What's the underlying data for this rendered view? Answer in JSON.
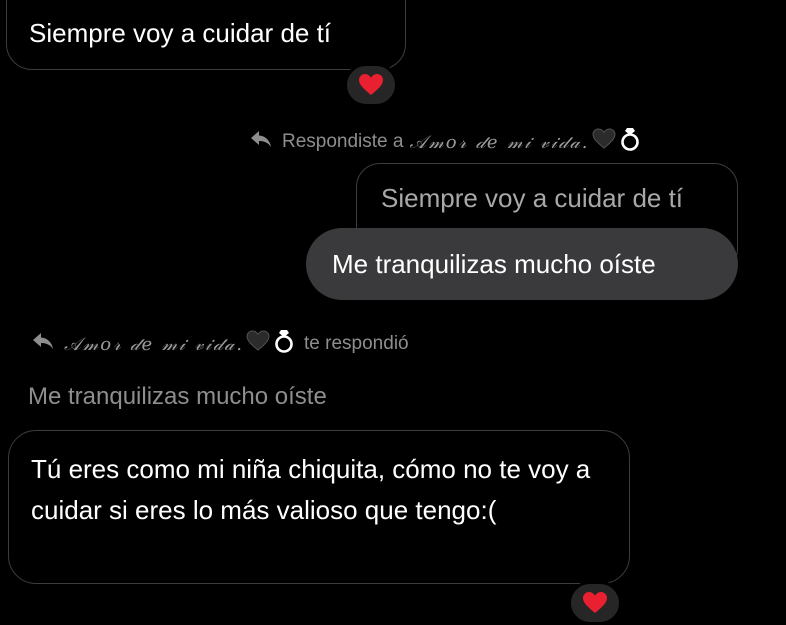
{
  "messages": {
    "first": "Siempre voy a cuidar de tí",
    "reply_meta": {
      "prefix": "Respondiste a",
      "name": "𝒜𝓂𝑜𝓇 𝒹𝑒 𝓂𝒾 𝓋𝒾𝒹𝒶."
    },
    "quoted_reply": "Siempre voy a cuidar de tí",
    "my_reply": "Me tranquilizas mucho oíste",
    "their_reply_meta": {
      "name": "𝒜𝓂𝑜𝓇 𝒹𝑒 𝓂𝒾 𝓋𝒾𝒹𝒶.",
      "suffix": "te respondió"
    },
    "quoted_their": "Me tranquilizas mucho oíste",
    "their_reply": "Tú eres como mi niña chiquita, cómo no te voy a cuidar si eres lo más valioso que tengo:("
  },
  "reactions": {
    "first": "heart-icon",
    "last": "heart-icon"
  },
  "colors": {
    "background": "#000000",
    "outgoing_bubble": "#3a3a3c",
    "outline": "#3d3d3d",
    "meta_text": "#8e8e8e",
    "heart": "#e8202f"
  }
}
